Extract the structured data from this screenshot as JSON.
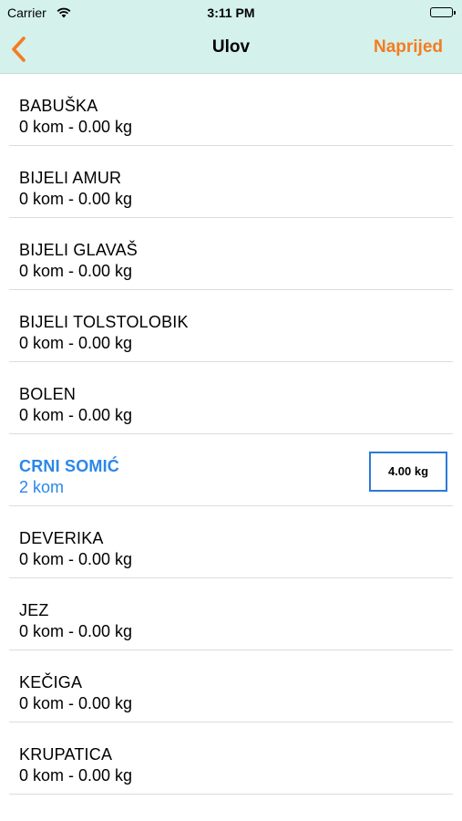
{
  "status_bar": {
    "carrier": "Carrier",
    "time": "3:11 PM"
  },
  "nav": {
    "title": "Ulov",
    "next_label": "Naprijed"
  },
  "colors": {
    "accent": "#f47c20",
    "selected": "#2b87e8",
    "header_bg": "#d4f1ec"
  },
  "icons": {
    "back": "chevron-left-icon",
    "wifi": "wifi-icon",
    "battery": "battery-icon"
  },
  "fish": [
    {
      "name": "BABUŠKA",
      "detail": "0 kom - 0.00 kg"
    },
    {
      "name": "BIJELI AMUR",
      "detail": "0 kom - 0.00 kg"
    },
    {
      "name": "BIJELI GLAVAŠ",
      "detail": "0 kom - 0.00 kg"
    },
    {
      "name": "BIJELI TOLSTOLOBIK",
      "detail": "0 kom - 0.00 kg"
    },
    {
      "name": "BOLEN",
      "detail": "0 kom - 0.00 kg"
    },
    {
      "name": "CRNI SOMIĆ",
      "detail": "2 kom",
      "weight_input": "4.00 kg",
      "selected": true
    },
    {
      "name": "DEVERIKA",
      "detail": "0 kom - 0.00 kg"
    },
    {
      "name": "JEZ",
      "detail": "0 kom - 0.00 kg"
    },
    {
      "name": "KEČIGA",
      "detail": "0 kom - 0.00 kg"
    },
    {
      "name": "KRUPATICA",
      "detail": "0 kom - 0.00 kg"
    }
  ]
}
